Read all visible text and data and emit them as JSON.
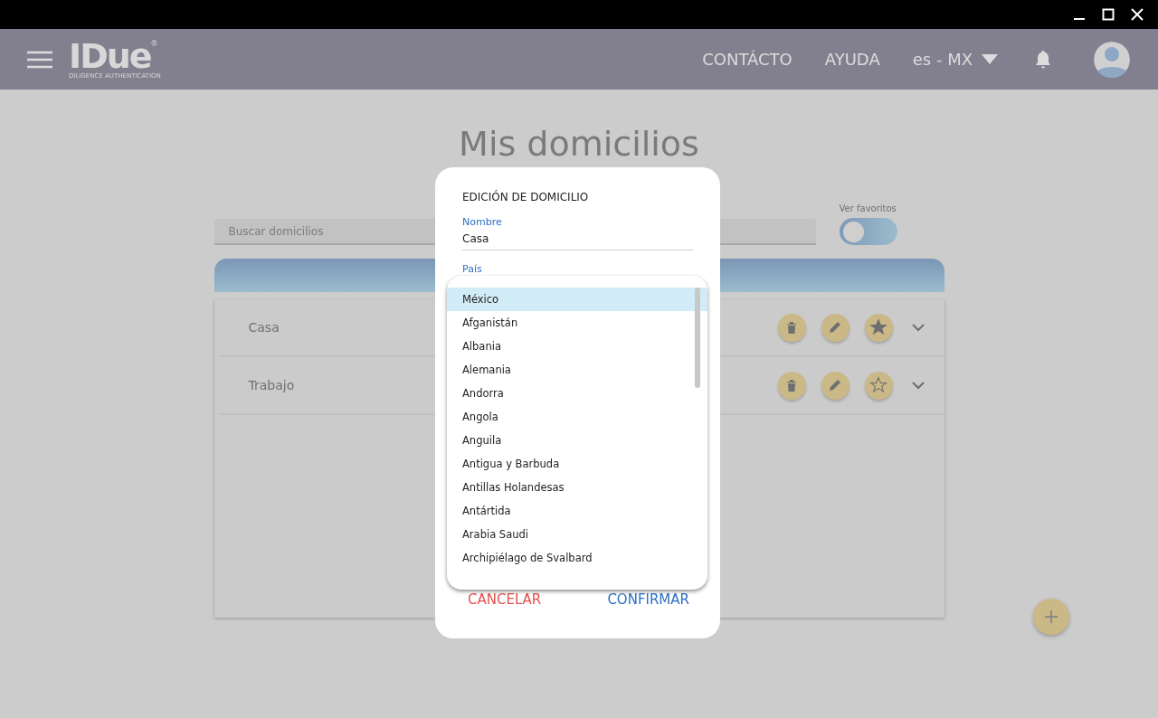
{
  "header": {
    "logo": "IDue",
    "logo_mark": "®",
    "logo_tagline": "DILIGENCE AUTHENTICATION",
    "nav": [
      "CONTÁCTO",
      "AYUDA"
    ],
    "language": "es - MX"
  },
  "page": {
    "title": "Mis domicilios",
    "search": {
      "placeholder": "Buscar domicilios"
    },
    "favorites_toggle": {
      "label": "Ver favoritos",
      "on": false
    },
    "addresses": [
      {
        "name": "Casa",
        "favorite": true
      },
      {
        "name": "Trabajo",
        "favorite": false
      }
    ]
  },
  "dialog": {
    "title": "EDICIÓN DE DOMICILIO",
    "name_label": "Nombre",
    "name_value": "Casa",
    "country_label": "País",
    "countries": [
      {
        "label": "México",
        "selected": true
      },
      {
        "label": "Afganistán",
        "selected": false
      },
      {
        "label": "Albania",
        "selected": false
      },
      {
        "label": "Alemania",
        "selected": false
      },
      {
        "label": "Andorra",
        "selected": false
      },
      {
        "label": "Angola",
        "selected": false
      },
      {
        "label": "Anguila",
        "selected": false
      },
      {
        "label": "Antigua y Barbuda",
        "selected": false
      },
      {
        "label": "Antillas Holandesas",
        "selected": false
      },
      {
        "label": "Antártida",
        "selected": false
      },
      {
        "label": "Arabia Saudi",
        "selected": false
      },
      {
        "label": "Archipiélago de Svalbard",
        "selected": false
      }
    ],
    "cancel": "CANCELAR",
    "confirm": "CONFIRMAR"
  }
}
